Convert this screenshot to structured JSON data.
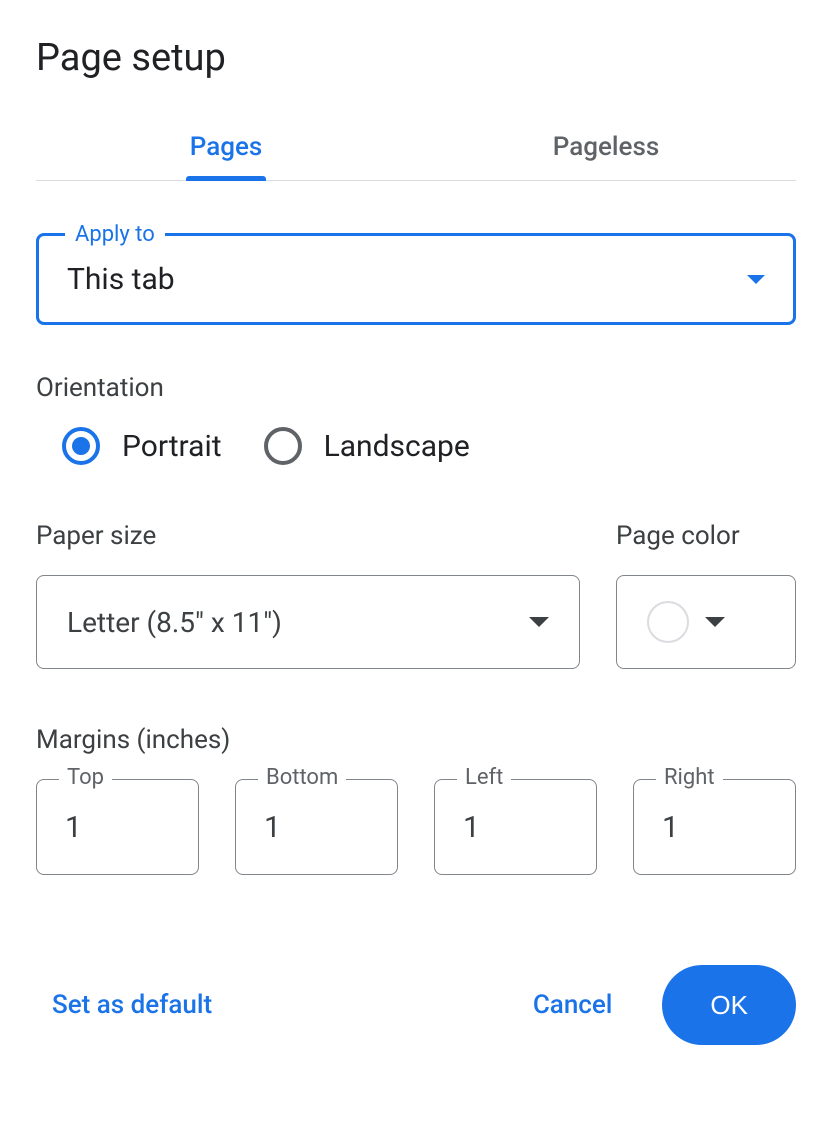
{
  "title": "Page setup",
  "tabs": {
    "pages": "Pages",
    "pageless": "Pageless"
  },
  "applyTo": {
    "label": "Apply to",
    "value": "This tab"
  },
  "orientation": {
    "label": "Orientation",
    "portrait": "Portrait",
    "landscape": "Landscape",
    "selected": "portrait"
  },
  "paperSize": {
    "label": "Paper size",
    "value": "Letter (8.5\" x 11\")"
  },
  "pageColor": {
    "label": "Page color",
    "value": "#ffffff"
  },
  "margins": {
    "label": "Margins (inches)",
    "top": {
      "label": "Top",
      "value": "1"
    },
    "bottom": {
      "label": "Bottom",
      "value": "1"
    },
    "left": {
      "label": "Left",
      "value": "1"
    },
    "right": {
      "label": "Right",
      "value": "1"
    }
  },
  "footer": {
    "setDefault": "Set as default",
    "cancel": "Cancel",
    "ok": "OK"
  }
}
